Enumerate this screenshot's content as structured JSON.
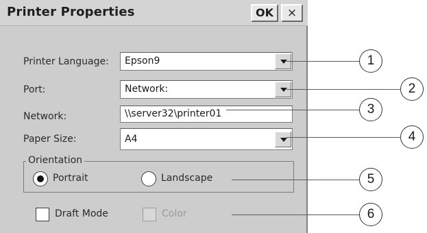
{
  "dialog": {
    "title": "Printer Properties",
    "ok_label": "OK",
    "close_label": "×"
  },
  "fields": {
    "printer_language": {
      "label": "Printer Language:",
      "value": "Epson9"
    },
    "port": {
      "label": "Port:",
      "value": "Network:"
    },
    "network": {
      "label": "Network:",
      "value": "\\\\server32\\printer01"
    },
    "paper_size": {
      "label": "Paper Size:",
      "value": "A4"
    }
  },
  "orientation": {
    "legend": "Orientation",
    "portrait_label": "Portrait",
    "landscape_label": "Landscape",
    "selected": "Portrait"
  },
  "options": {
    "draft_mode_label": "Draft Mode",
    "draft_mode_checked": false,
    "color_label": "Color",
    "color_checked": false,
    "color_enabled": false
  },
  "callouts": [
    "1",
    "2",
    "3",
    "4",
    "5",
    "6"
  ]
}
